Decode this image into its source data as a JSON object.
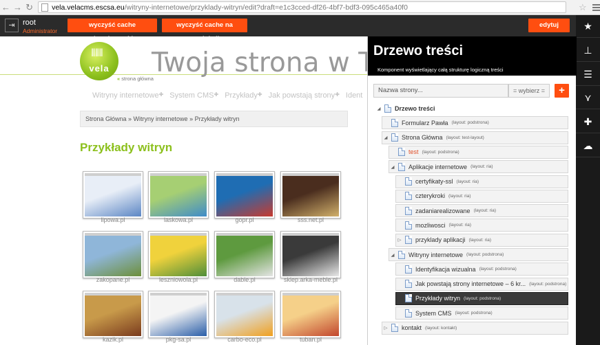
{
  "browser": {
    "url_domain": "vela.velacms.escsa.eu",
    "url_rest": "/witryny-internetowe/przyklady-witryn/edit?draft=e1c3cced-df26-4bf7-bdf3-095c465a40f0"
  },
  "cms_bar": {
    "username": "root",
    "role": "Administrator",
    "clear_dev_cache": "wyczyść cache deweloperski",
    "clear_prod_cache": "wyczyść cache na produkcji",
    "edit": "edytuj"
  },
  "site": {
    "logo_text": "vela",
    "title": "Twoja strona w Two",
    "home_arrow": "«",
    "home_link": "strona główna",
    "menu": [
      "Witryny internetowe",
      "System CMS",
      "Przykłady",
      "Jak powstają strony",
      "Ident"
    ],
    "menu_plus": "✚",
    "breadcrumb": "Strona Główna » Witryny internetowe » Przykłady witryn",
    "heading": "Przykłady witryn",
    "thumbnails": [
      {
        "label": "lipowa.pl",
        "c1": "#e8eef7",
        "c2": "#5c86c4"
      },
      {
        "label": "laskowa.pl",
        "c1": "#a6cf73",
        "c2": "#3f8bc9"
      },
      {
        "label": "gopr.pl",
        "c1": "#1f6db3",
        "c2": "#c73a2f"
      },
      {
        "label": "sss.net.pl",
        "c1": "#4a2d1e",
        "c2": "#d1b06b"
      },
      {
        "label": "zakopane.pl",
        "c1": "#8fb6d9",
        "c2": "#6d8f3a"
      },
      {
        "label": "leszniowola.pl",
        "c1": "#f0d23c",
        "c2": "#4f8e3a"
      },
      {
        "label": "dable.pl",
        "c1": "#5e9a3f",
        "c2": "#e4e4e4"
      },
      {
        "label": "sklep.arka-meble.pl",
        "c1": "#3a3a3a",
        "c2": "#e8e8e8"
      },
      {
        "label": "kazik.pl",
        "c1": "#c89a4a",
        "c2": "#7a3b1e"
      },
      {
        "label": "pkg-sa.pl",
        "c1": "#f4f4f4",
        "c2": "#2a5ea8"
      },
      {
        "label": "carbo-eco.pl",
        "c1": "#d8e2ea",
        "c2": "#f0a020"
      },
      {
        "label": "tuban.pl",
        "c1": "#f5d089",
        "c2": "#c2472d"
      }
    ]
  },
  "panel": {
    "title": "Drzewo treści",
    "subtitle": "Komponent wyświetlający całą strukturę logiczną treści",
    "search_placeholder": "Nazwa strony...",
    "filter": "= wybierz =",
    "add": "+",
    "tree": [
      {
        "label": "Drzewo treści",
        "tag": "",
        "twisty": "◢"
      },
      {
        "label": "Formularz Pawła",
        "tag": "(layout: podstrona)",
        "twisty": ""
      },
      {
        "label": "Strona Główna",
        "tag": "(layout: test-layout)",
        "twisty": "◢"
      },
      {
        "label": "test",
        "tag": "(layout: podstrona)",
        "twisty": ""
      },
      {
        "label": "Aplikacje internetowe",
        "tag": "(layout: ria)",
        "twisty": "◢"
      },
      {
        "label": "certyfikaty-ssl",
        "tag": "(layout: ria)",
        "twisty": ""
      },
      {
        "label": "czterykroki",
        "tag": "(layout: ria)",
        "twisty": ""
      },
      {
        "label": "zadaniarealizowane",
        "tag": "(layout: ria)",
        "twisty": ""
      },
      {
        "label": "mozliwosci",
        "tag": "(layout: ria)",
        "twisty": ""
      },
      {
        "label": "przyklady aplikacji",
        "tag": "(layout: ria)",
        "twisty": "▷"
      },
      {
        "label": "Witryny internetowe",
        "tag": "(layout: podstrona)",
        "twisty": "◢"
      },
      {
        "label": "Identyfikacja wizualna",
        "tag": "(layout: podstrona)",
        "twisty": ""
      },
      {
        "label": "Jak powstają strony internetowe – 6 kr...",
        "tag": "(layout: podstrona)",
        "twisty": ""
      },
      {
        "label": "Przykłady witryn",
        "tag": "(layout: podstrona)",
        "twisty": ""
      },
      {
        "label": "System CMS",
        "tag": "(layout: podstrona)",
        "twisty": ""
      },
      {
        "label": "kontakt",
        "tag": "(layout: kontakt)",
        "twisty": "▷"
      }
    ]
  },
  "rail_icons": [
    "star-icon",
    "sitemap-icon",
    "list-icon",
    "share-icon",
    "puzzle-icon",
    "cloud-upload-icon"
  ],
  "colors": {
    "accent": "#ff4e10",
    "brand_green": "#8cc01d",
    "panel_bg": "#000000"
  }
}
